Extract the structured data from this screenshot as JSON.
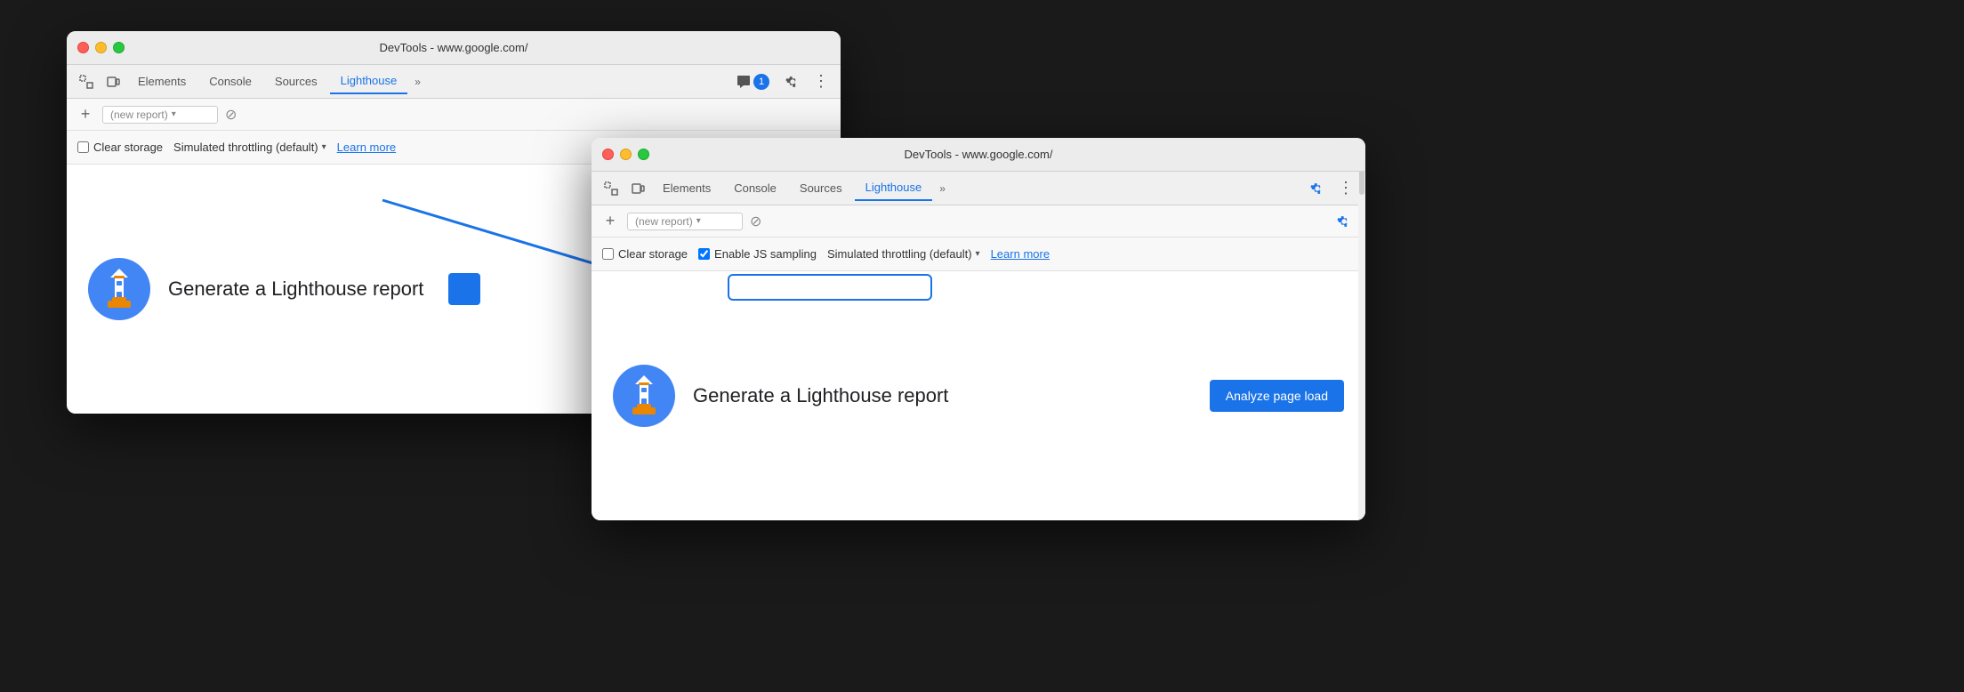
{
  "window_back": {
    "title": "DevTools - www.google.com/",
    "tabs": [
      "Elements",
      "Console",
      "Sources",
      "Lighthouse"
    ],
    "active_tab": "Lighthouse",
    "report_placeholder": "(new report)",
    "clear_storage_label": "Clear storage",
    "throttle_label": "Simulated throttling (default)",
    "learn_more_label": "Learn more",
    "generate_label": "Generate a Lighthouse report",
    "badge_count": "1"
  },
  "window_front": {
    "title": "DevTools - www.google.com/",
    "tabs": [
      "Elements",
      "Console",
      "Sources",
      "Lighthouse"
    ],
    "active_tab": "Lighthouse",
    "report_placeholder": "(new report)",
    "clear_storage_label": "Clear storage",
    "enable_js_label": "Enable JS sampling",
    "throttle_label": "Simulated throttling (default)",
    "learn_more_label": "Learn more",
    "generate_label": "Generate a Lighthouse report",
    "analyze_label": "Analyze page load"
  },
  "icons": {
    "add": "+",
    "chevron_down": "▾",
    "circle_cancel": "⊘",
    "more_vert": "⋮",
    "chevron_right": "»"
  }
}
